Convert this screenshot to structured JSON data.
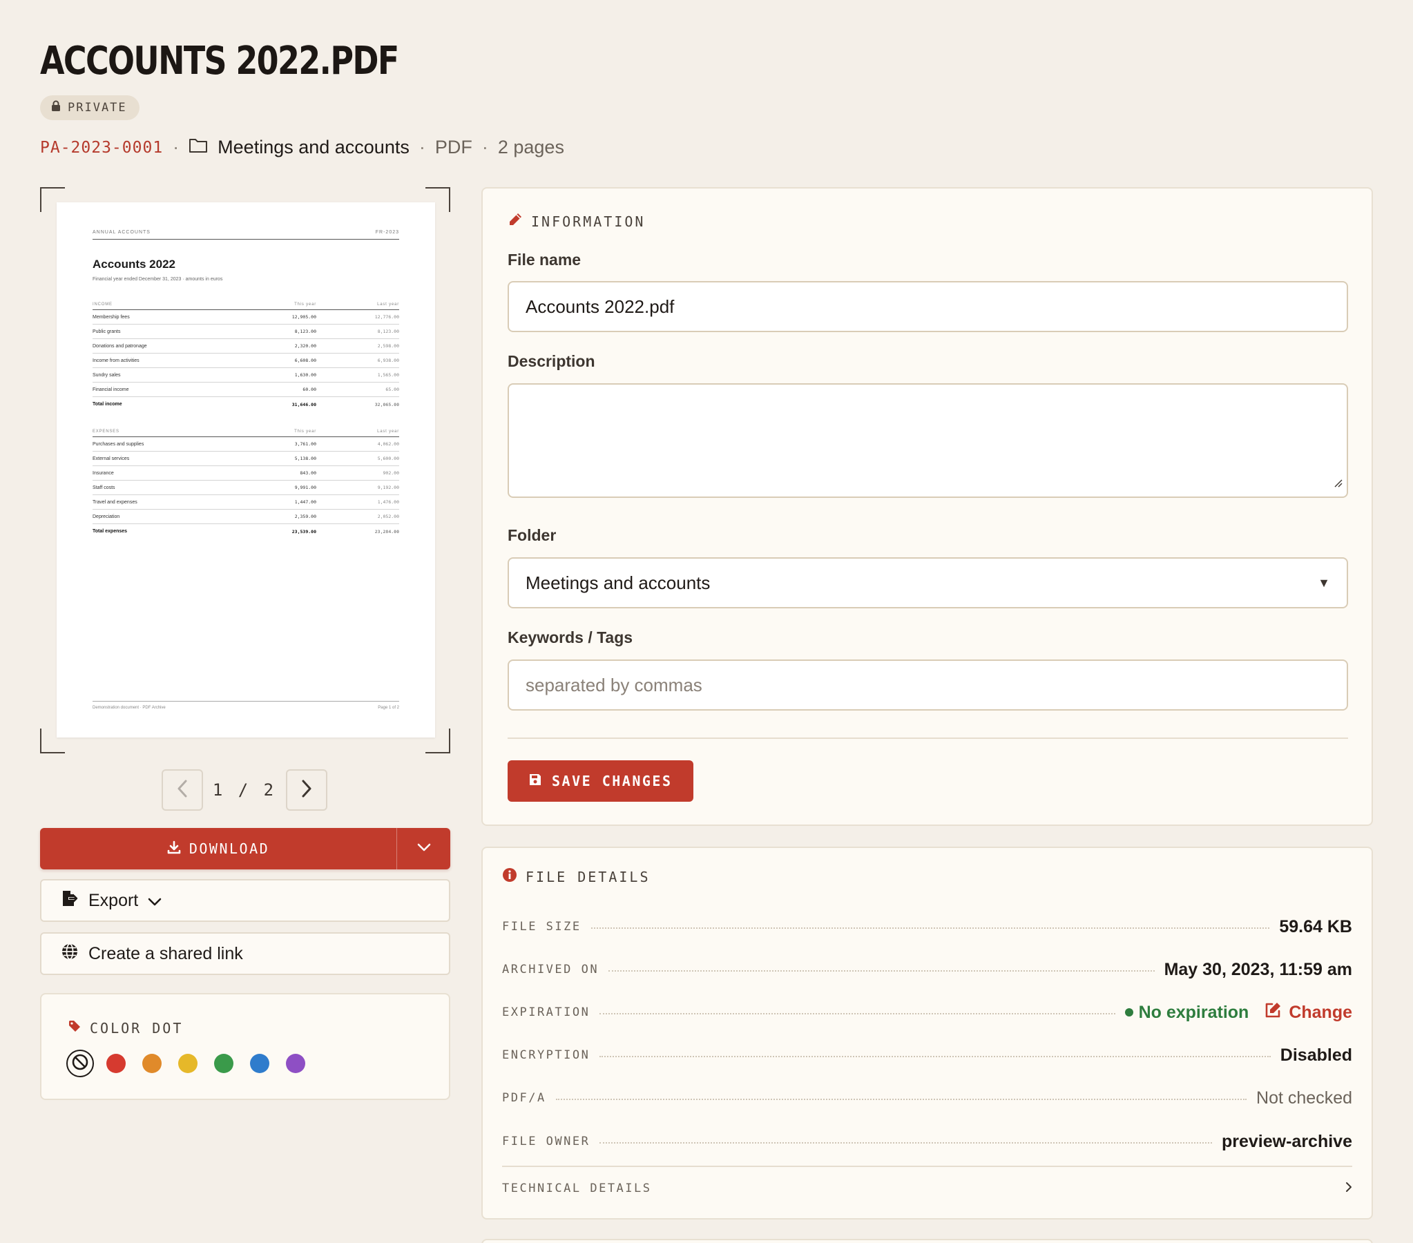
{
  "header": {
    "title": "ACCOUNTS 2022.PDF",
    "badge": "PRIVATE",
    "reference": "PA-2023-0001",
    "folder": "Meetings and accounts",
    "format": "PDF",
    "pages": "2 pages",
    "separator": "·"
  },
  "preview": {
    "header_left": "ANNUAL ACCOUNTS",
    "header_right": "FR-2023",
    "title": "Accounts 2022",
    "subtitle": "Financial year ended December 31, 2023 · amounts in euros",
    "col_this_year": "This year",
    "col_last_year": "Last year",
    "income": {
      "heading": "INCOME",
      "rows": [
        {
          "label": "Membership fees",
          "this": "12,905.00",
          "last": "12,776.00"
        },
        {
          "label": "Public grants",
          "this": "8,123.00",
          "last": "8,123.00"
        },
        {
          "label": "Donations and patronage",
          "this": "2,320.00",
          "last": "2,598.00"
        },
        {
          "label": "Income from activities",
          "this": "6,608.00",
          "last": "6,938.00"
        },
        {
          "label": "Sundry sales",
          "this": "1,630.00",
          "last": "1,565.00"
        },
        {
          "label": "Financial income",
          "this": "60.00",
          "last": "65.00"
        }
      ],
      "total": {
        "label": "Total income",
        "this": "31,646.00",
        "last": "32,065.00"
      }
    },
    "expenses": {
      "heading": "EXPENSES",
      "rows": [
        {
          "label": "Purchases and supplies",
          "this": "3,761.00",
          "last": "4,062.00"
        },
        {
          "label": "External services",
          "this": "5,138.00",
          "last": "5,600.00"
        },
        {
          "label": "Insurance",
          "this": "843.00",
          "last": "902.00"
        },
        {
          "label": "Staff costs",
          "this": "9,991.00",
          "last": "9,192.00"
        },
        {
          "label": "Travel and expenses",
          "this": "1,447.00",
          "last": "1,476.00"
        },
        {
          "label": "Depreciation",
          "this": "2,359.00",
          "last": "2,052.00"
        }
      ],
      "total": {
        "label": "Total expenses",
        "this": "23,539.00",
        "last": "23,284.00"
      }
    },
    "footer_left": "Demonstration document · PDF Archive",
    "footer_right": "Page 1 of 2"
  },
  "pager": {
    "text": "1 / 2"
  },
  "actions": {
    "download": "DOWNLOAD",
    "export": "Export",
    "share": "Create a shared link"
  },
  "color_dot": {
    "heading": "COLOR DOT",
    "colors": [
      "#d63a2f",
      "#e08a2a",
      "#e6b829",
      "#3a9a4a",
      "#2f7ccc",
      "#8e4fc4"
    ]
  },
  "information": {
    "heading": "INFORMATION",
    "file_name_label": "File name",
    "file_name_value": "Accounts 2022.pdf",
    "description_label": "Description",
    "description_value": "",
    "folder_label": "Folder",
    "folder_value": "Meetings and accounts",
    "keywords_label": "Keywords / Tags",
    "keywords_placeholder": "separated by commas",
    "save_label": "SAVE CHANGES"
  },
  "details": {
    "heading": "FILE DETAILS",
    "file_size_label": "FILE SIZE",
    "file_size": "59.64 KB",
    "archived_label": "ARCHIVED ON",
    "archived": "May 30, 2023, 11:59 am",
    "expiration_label": "EXPIRATION",
    "expiration": "No expiration",
    "change": "Change",
    "encryption_label": "ENCRYPTION",
    "encryption": "Disabled",
    "pdfa_label": "PDF/A",
    "pdfa": "Not checked",
    "owner_label": "FILE OWNER",
    "owner": "preview-archive",
    "technical_label": "TECHNICAL DETAILS"
  },
  "theme": {
    "accent": "#c13b2c",
    "success": "#2e7d3e",
    "background": "#f4efe8"
  }
}
